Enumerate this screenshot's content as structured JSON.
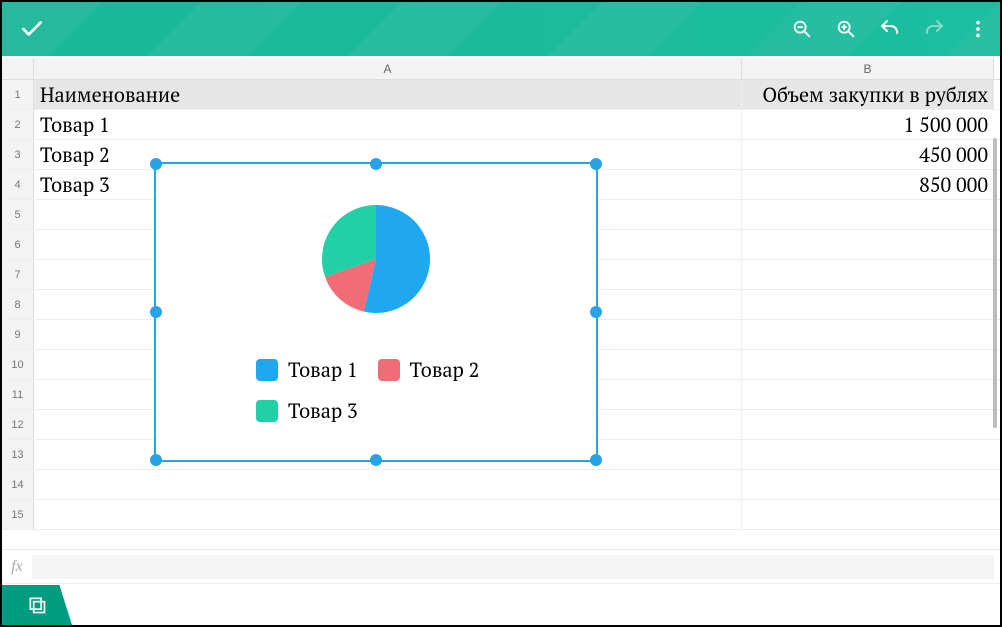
{
  "toolbar": {
    "confirm_icon": "check",
    "zoom_out_icon": "zoom-out",
    "zoom_in_icon": "zoom-in",
    "undo_icon": "undo",
    "redo_icon": "redo",
    "more_icon": "more-vert"
  },
  "columns": {
    "A": "A",
    "B": "B"
  },
  "rows": [
    {
      "num": "1",
      "A": "Наименование",
      "B": "Объем закупки в рублях",
      "header": true
    },
    {
      "num": "2",
      "A": "Товар 1",
      "B": "1 500 000"
    },
    {
      "num": "3",
      "A": "Товар 2",
      "B": "450 000"
    },
    {
      "num": "4",
      "A": "Товар 3",
      "B": "850 000"
    },
    {
      "num": "5",
      "A": "",
      "B": ""
    },
    {
      "num": "6",
      "A": "",
      "B": ""
    },
    {
      "num": "7",
      "A": "",
      "B": ""
    },
    {
      "num": "8",
      "A": "",
      "B": ""
    },
    {
      "num": "9",
      "A": "",
      "B": ""
    },
    {
      "num": "10",
      "A": "",
      "B": ""
    },
    {
      "num": "11",
      "A": "",
      "B": ""
    },
    {
      "num": "12",
      "A": "",
      "B": ""
    },
    {
      "num": "13",
      "A": "",
      "B": ""
    },
    {
      "num": "14",
      "A": "",
      "B": ""
    },
    {
      "num": "15",
      "A": "",
      "B": ""
    }
  ],
  "chart_data": {
    "type": "pie",
    "title": "",
    "categories": [
      "Товар 1",
      "Товар 2",
      "Товар 3"
    ],
    "values": [
      1500000,
      450000,
      850000
    ],
    "colors": [
      "#1fa8f0",
      "#f06d78",
      "#22d0a8"
    ],
    "legend": {
      "position": "bottom",
      "items": [
        {
          "label": "Товар 1",
          "color": "#1fa8f0"
        },
        {
          "label": "Товар 2",
          "color": "#f06d78"
        },
        {
          "label": "Товар 3",
          "color": "#22d0a8"
        }
      ]
    }
  },
  "fx": {
    "label": "fx",
    "value": ""
  },
  "sheet_tab": {
    "icon": "sheets"
  }
}
